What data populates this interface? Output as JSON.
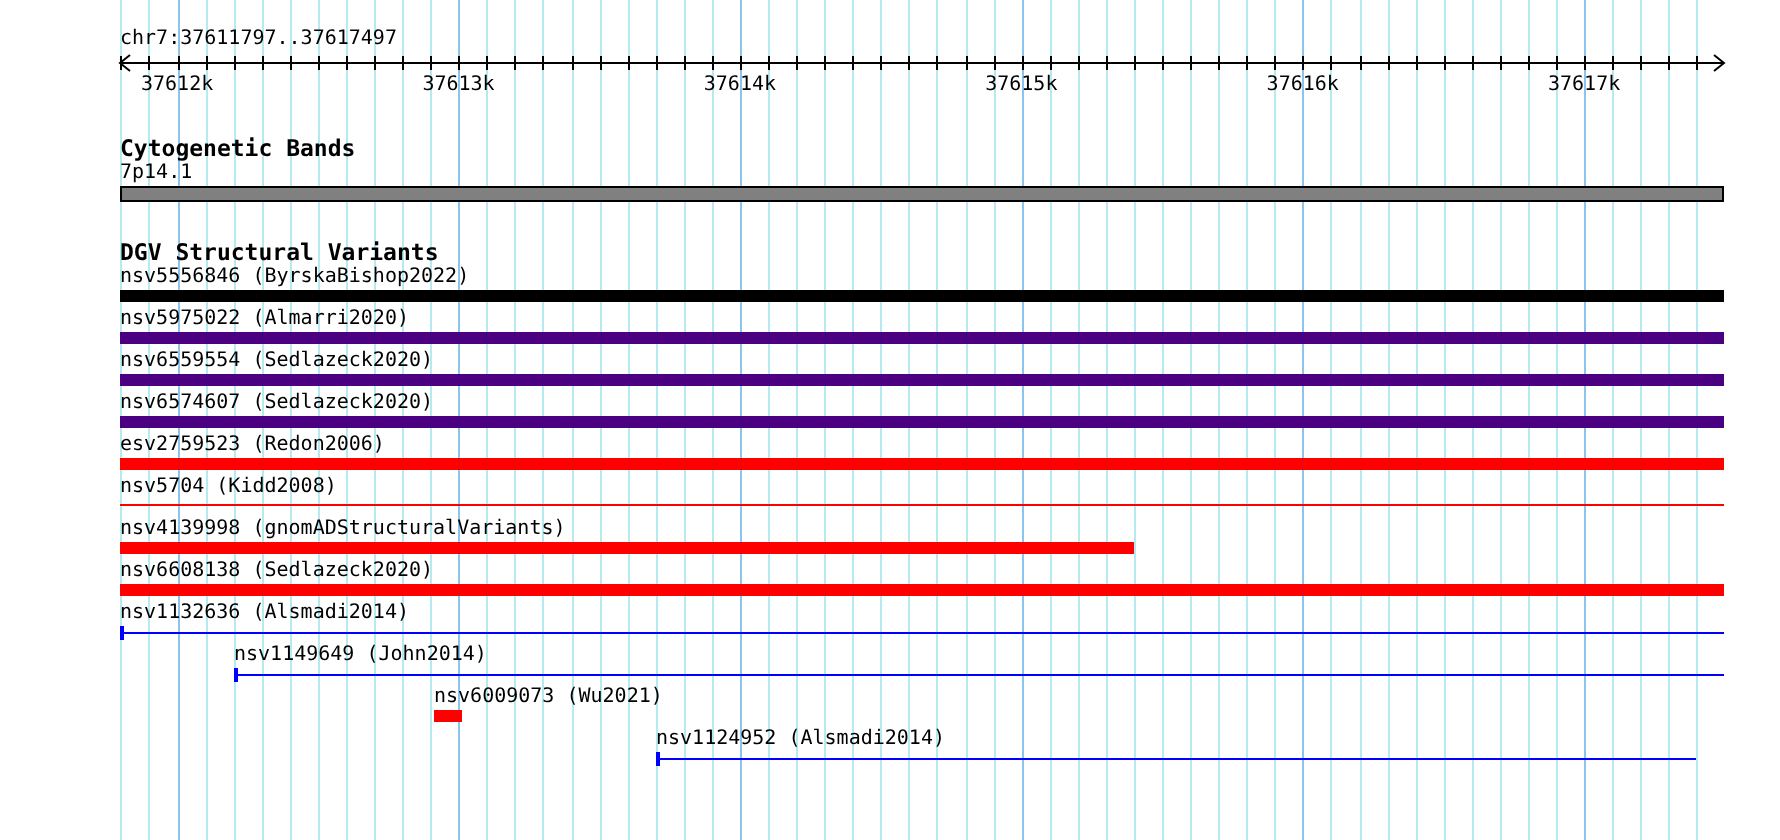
{
  "ruler": {
    "location": "chr7:37611797..37617497",
    "ticks": [
      "37612k",
      "37613k",
      "37614k",
      "37615k",
      "37616k",
      "37617k"
    ]
  },
  "tracks": [
    {
      "title": "Cytogenetic Bands",
      "features": [
        {
          "label": "7p14.1",
          "kind": "band",
          "color": "#808080"
        }
      ]
    },
    {
      "title": "DGV Structural Variants",
      "features": [
        {
          "label": "nsv5556846 (ByrskaBishop2022)",
          "kind": "bar",
          "color": "#000000"
        },
        {
          "label": "nsv5975022 (Almarri2020)",
          "kind": "bar",
          "color": "#4b0082"
        },
        {
          "label": "nsv6559554 (Sedlazeck2020)",
          "kind": "bar",
          "color": "#4b0082"
        },
        {
          "label": "nsv6574607 (Sedlazeck2020)",
          "kind": "bar",
          "color": "#4b0082"
        },
        {
          "label": "esv2759523 (Redon2006)",
          "kind": "bar",
          "color": "#ff0000"
        },
        {
          "label": "nsv5704 (Kidd2008)",
          "kind": "line",
          "color": "#ff0000"
        },
        {
          "label": "nsv4139998 (gnomADStructuralVariants)",
          "kind": "bar",
          "color": "#ff0000"
        },
        {
          "label": "nsv6608138 (Sedlazeck2020)",
          "kind": "bar",
          "color": "#ff0000"
        },
        {
          "label": "nsv1132636 (Alsmadi2014)",
          "kind": "range",
          "color": "#0000ff"
        },
        {
          "label": "nsv1149649 (John2014)",
          "kind": "range",
          "color": "#0000ff"
        },
        {
          "label": "nsv6009073 (Wu2021)",
          "kind": "bar",
          "color": "#ff0000"
        },
        {
          "label": "nsv1124952 (Alsmadi2014)",
          "kind": "range",
          "color": "#0000ff"
        }
      ]
    }
  ]
}
